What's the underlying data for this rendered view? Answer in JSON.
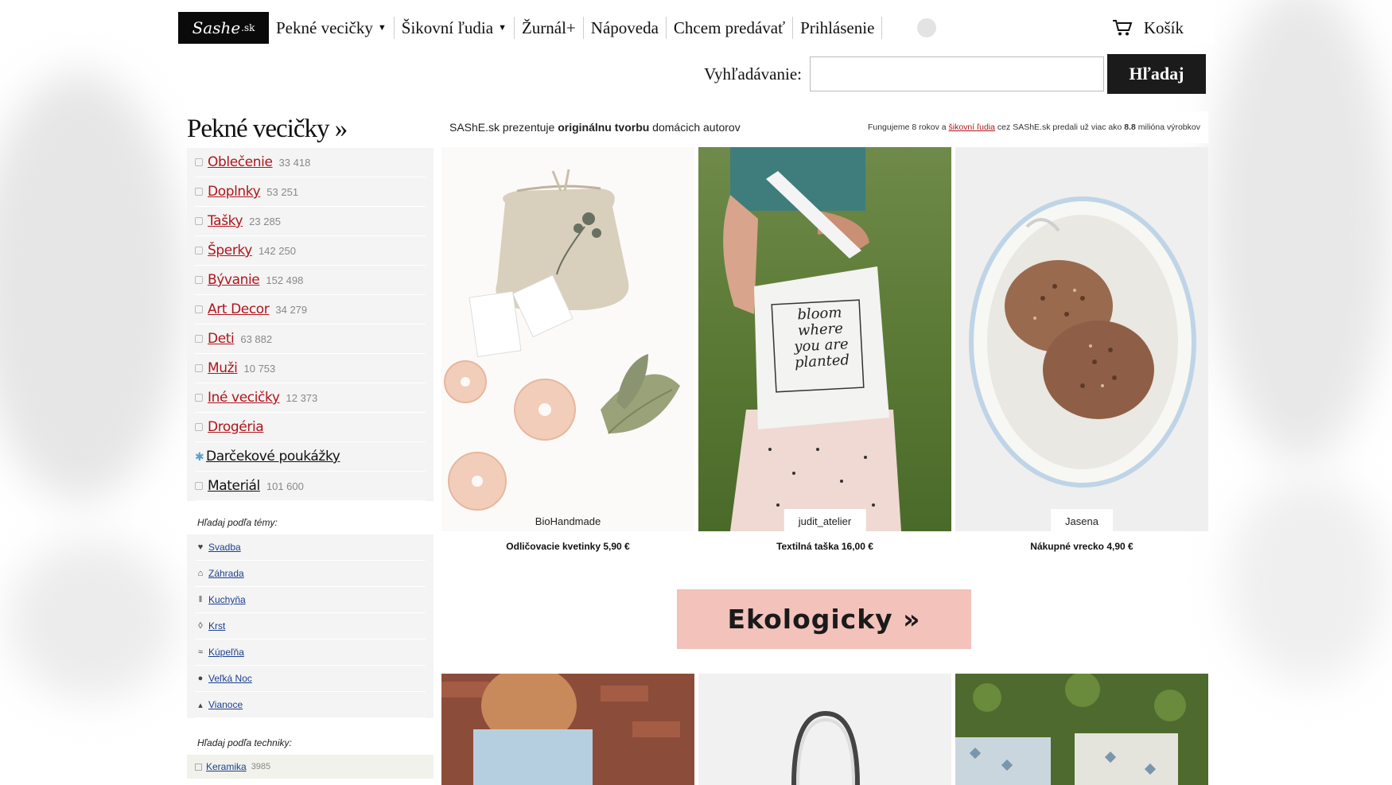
{
  "logo": {
    "text": "Sashe",
    "suffix": ".sk"
  },
  "nav": {
    "items": [
      "Pekné vecičky",
      "Šikovní ľudia",
      "Žurnál+",
      "Nápoveda",
      "Chcem predávať",
      "Prihlásenie"
    ],
    "cart_label": "Košík"
  },
  "search": {
    "label": "Vyhľadávanie:",
    "value": "",
    "button_label": "Hľadaj"
  },
  "sidebar": {
    "title": "Pekné vecičky »",
    "categories": [
      {
        "label": "Oblečenie",
        "count": "33 418"
      },
      {
        "label": "Doplnky",
        "count": "53 251"
      },
      {
        "label": "Tašky",
        "count": "23 285"
      },
      {
        "label": "Šperky",
        "count": "142 250"
      },
      {
        "label": "Bývanie",
        "count": "152 498"
      },
      {
        "label": "Art Decor",
        "count": "34 279"
      },
      {
        "label": "Deti",
        "count": "63 882"
      },
      {
        "label": "Muži",
        "count": "10 753"
      },
      {
        "label": "Iné vecičky",
        "count": "12 373"
      },
      {
        "label": "Drogéria",
        "count": ""
      },
      {
        "label": "Darčekové poukážky",
        "count": ""
      },
      {
        "label": "Materiál",
        "count": "101 600"
      }
    ],
    "theme_heading": "Hľadaj podľa témy:",
    "themes": [
      {
        "label": "Svadba",
        "icon": "heart-icon"
      },
      {
        "label": "Záhrada",
        "icon": "house-icon"
      },
      {
        "label": "Kuchyňa",
        "icon": "cutlery-icon"
      },
      {
        "label": "Krst",
        "icon": "drop-icon"
      },
      {
        "label": "Kúpeľňa",
        "icon": "waves-icon"
      },
      {
        "label": "Veľká Noc",
        "icon": "egg-icon"
      },
      {
        "label": "Vianoce",
        "icon": "tree-icon"
      }
    ],
    "technique_heading": "Hľadaj podľa techniky:",
    "techniques": [
      {
        "label": "Keramika",
        "count": "3985"
      }
    ]
  },
  "main": {
    "intro_pre": "SAShE.sk prezentuje ",
    "intro_bold": "originálnu tvorbu",
    "intro_post": " domácich autorov",
    "stats_pre": "Fungujeme 8 rokov a ",
    "stats_link": "šikovní ľudia",
    "stats_mid": " cez SAShE.sk predali už viac ako ",
    "stats_bold": "8.8",
    "stats_post": " milióna výrobkov",
    "products": [
      {
        "shop": "BioHandmade",
        "title": "Odličovacie kvetinky 5,90 €"
      },
      {
        "shop": "judit_atelier",
        "title": "Textilná taška 16,00 €"
      },
      {
        "shop": "Jasena",
        "title": "Nákupné vrecko 4,90 €"
      }
    ],
    "bag_text": [
      "bloom",
      "where",
      "you are",
      "planted"
    ],
    "cta_label": "Ekologicky »"
  },
  "colors": {
    "accent_red": "#b0141b",
    "cta_pink": "#f2c2bb",
    "link_blue": "#1b3f8f",
    "dark": "#1b1b1b"
  }
}
